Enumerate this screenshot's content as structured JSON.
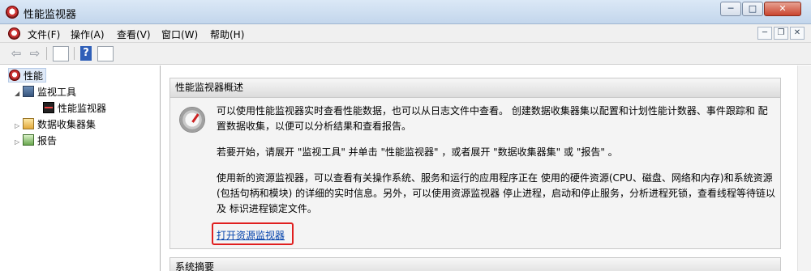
{
  "window": {
    "title": "性能监视器",
    "buttons": {
      "minimize": "─",
      "maximize": "□",
      "close": "✕"
    }
  },
  "menubar": {
    "items": [
      "文件(F)",
      "操作(A)",
      "查看(V)",
      "窗口(W)",
      "帮助(H)"
    ],
    "mdi_buttons": {
      "minimize": "─",
      "restore": "❐",
      "close": "✕"
    }
  },
  "toolbar": {
    "back_icon": "left-arrow-icon",
    "forward_icon": "right-arrow-icon",
    "help_label": "?"
  },
  "tree": {
    "root": "性能",
    "items": [
      {
        "label": "监视工具",
        "icon": "tools-icon"
      },
      {
        "label": "性能监视器",
        "icon": "monitor-icon"
      },
      {
        "label": "数据收集器集",
        "icon": "data-collector-icon"
      },
      {
        "label": "报告",
        "icon": "report-icon"
      }
    ]
  },
  "main": {
    "overview_title": "性能监视器概述",
    "paragraph1": "可以使用性能监视器实时查看性能数据，也可以从日志文件中查看。 创建数据收集器集以配置和计划性能计数器、事件跟踪和 配置数据收集，以便可以分析结果和查看报告。",
    "paragraph2": "若要开始，请展开 \"监视工具\" 并单击 \"性能监视器\" ，或者展开 \"数据收集器集\" 或 \"报告\" 。",
    "paragraph3": "使用新的资源监视器，可以查看有关操作系统、服务和运行的应用程序正在 使用的硬件资源(CPU、磁盘、网络和内存)和系统资源(包括句柄和模块) 的详细的实时信息。另外，可以使用资源监视器 停止进程，启动和停止服务，分析进程死锁，查看线程等待链以及 标识进程锁定文件。",
    "link": "打开资源监视器",
    "summary_title": "系统摘要"
  },
  "colors": {
    "link": "#0645ad",
    "highlight": "#e01f1f",
    "selection": "#dfe9f7"
  }
}
